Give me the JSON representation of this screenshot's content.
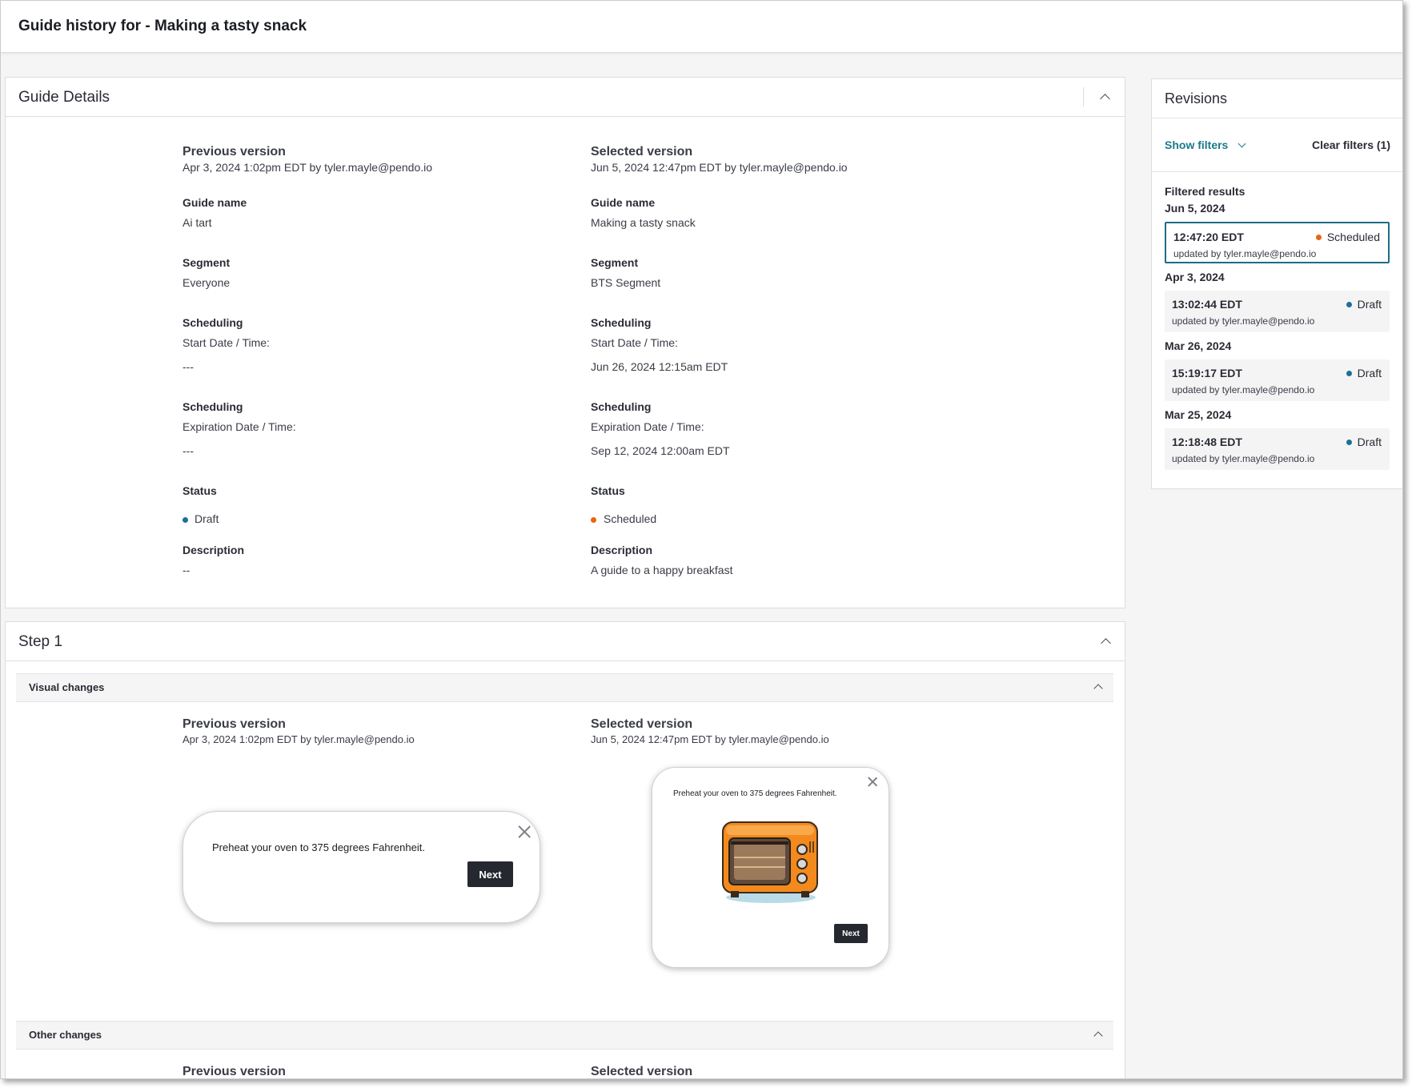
{
  "page_title": "Guide history for - Making a tasty snack",
  "guide_details": {
    "title": "Guide Details",
    "previous": {
      "heading": "Previous version",
      "meta": "Apr 3, 2024 1:02pm EDT by tyler.mayle@pendo.io",
      "guide_name_label": "Guide name",
      "guide_name": "Ai tart",
      "segment_label": "Segment",
      "segment": "Everyone",
      "scheduling_label": "Scheduling",
      "start_label": "Start Date / Time:",
      "start_value": "---",
      "scheduling_label_2": "Scheduling",
      "expiration_label": "Expiration Date / Time:",
      "expiration_value": "---",
      "status_label": "Status",
      "status": "Draft",
      "description_label": "Description",
      "description": "--"
    },
    "selected": {
      "heading": "Selected version",
      "meta": "Jun 5, 2024 12:47pm EDT by tyler.mayle@pendo.io",
      "guide_name_label": "Guide name",
      "guide_name": "Making a tasty snack",
      "segment_label": "Segment",
      "segment": "BTS Segment",
      "scheduling_label": "Scheduling",
      "start_label": "Start Date / Time:",
      "start_value": "Jun 26, 2024 12:15am EDT",
      "scheduling_label_2": "Scheduling",
      "expiration_label": "Expiration Date / Time:",
      "expiration_value": "Sep 12, 2024 12:00am EDT",
      "status_label": "Status",
      "status": "Scheduled",
      "description_label": "Description",
      "description": "A guide to a happy breakfast"
    }
  },
  "step1": {
    "title": "Step 1",
    "visual_changes": {
      "title": "Visual changes",
      "previous": {
        "heading": "Previous version",
        "meta": "Apr 3, 2024 1:02pm EDT by tyler.mayle@pendo.io",
        "message": "Preheat your oven to 375 degrees Fahrenheit.",
        "button": "Next"
      },
      "selected": {
        "heading": "Selected version",
        "meta": "Jun 5, 2024 12:47pm EDT by tyler.mayle@pendo.io",
        "message": "Preheat your oven to 375 degrees Fahrenheit.",
        "button": "Next"
      }
    },
    "other_changes": {
      "title": "Other changes",
      "previous_heading": "Previous version",
      "selected_heading": "Selected version"
    }
  },
  "revisions": {
    "title": "Revisions",
    "show_filters": "Show filters",
    "clear_filters": "Clear filters (1)",
    "filtered_label": "Filtered results",
    "groups": [
      {
        "date": "Jun 5, 2024",
        "time": "12:47:20 EDT",
        "status": "Scheduled",
        "status_color": "#e8640f",
        "by": "updated by tyler.mayle@pendo.io",
        "selected": true
      },
      {
        "date": "Apr 3, 2024",
        "time": "13:02:44 EDT",
        "status": "Draft",
        "status_color": "#1f6f9a",
        "by": "updated by tyler.mayle@pendo.io",
        "selected": false
      },
      {
        "date": "Mar 26, 2024",
        "time": "15:19:17 EDT",
        "status": "Draft",
        "status_color": "#1f6f9a",
        "by": "updated by tyler.mayle@pendo.io",
        "selected": false
      },
      {
        "date": "Mar 25, 2024",
        "time": "12:18:48 EDT",
        "status": "Draft",
        "status_color": "#1f6f9a",
        "by": "updated by tyler.mayle@pendo.io",
        "selected": false
      }
    ]
  },
  "colors": {
    "accent_teal": "#1c7a8c",
    "draft_blue": "#1f6f9a",
    "scheduled_orange": "#e8640f",
    "button_dark": "#26282f"
  }
}
